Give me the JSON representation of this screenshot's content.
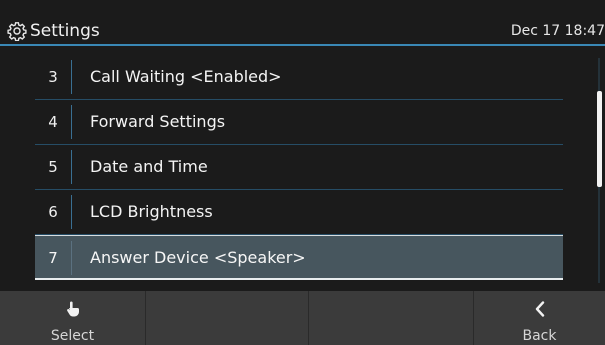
{
  "header": {
    "title": "Settings",
    "clock": "Dec 17 18:47",
    "icon": "gear-icon"
  },
  "menu": {
    "items": [
      {
        "number": "3",
        "label": "Call Waiting <Enabled>"
      },
      {
        "number": "4",
        "label": "Forward Settings"
      },
      {
        "number": "5",
        "label": "Date and Time"
      },
      {
        "number": "6",
        "label": "LCD Brightness"
      },
      {
        "number": "7",
        "label": "Answer Device <Speaker>"
      }
    ],
    "selected_number": "7"
  },
  "softkeys": {
    "select": {
      "label": "Select",
      "icon": "hand-pointer-icon"
    },
    "empty1": {
      "label": ""
    },
    "empty2": {
      "label": ""
    },
    "back": {
      "label": "Back",
      "icon": "chevron-left-icon"
    }
  },
  "colors": {
    "background": "#1b1b1b",
    "accent": "#3a88b6",
    "selected_row": "#47565e",
    "softkey_bar": "#3b3b3b"
  }
}
